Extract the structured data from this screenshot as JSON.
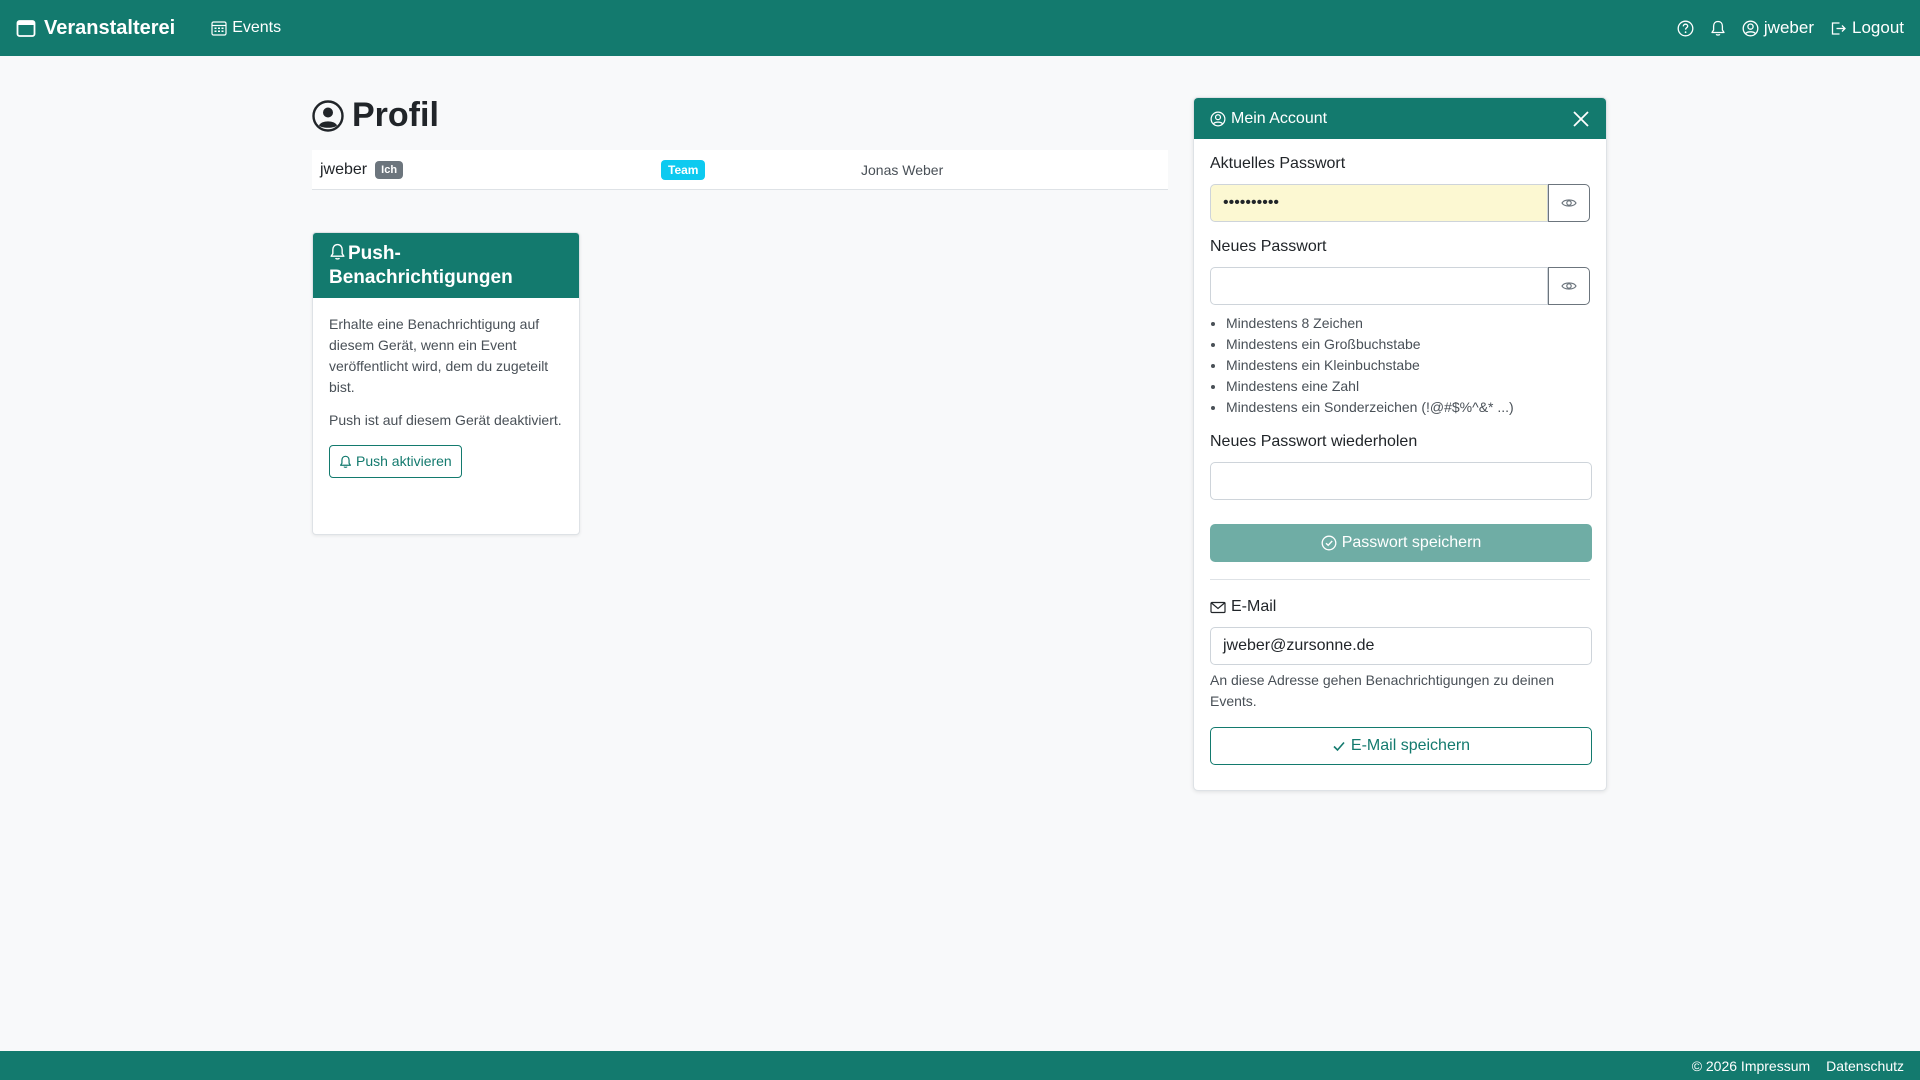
{
  "navbar": {
    "brand": "Veranstalterei",
    "events_label": "Events",
    "username": "jweber",
    "logout_label": "Logout"
  },
  "profile": {
    "title": "Profil",
    "username": "jweber",
    "me_badge": "Ich",
    "role_badge": "Team",
    "full_name": "Jonas Weber"
  },
  "push": {
    "title": "Push-Benachrichtigungen",
    "description": "Erhalte eine Benachrichtigung auf diesem Gerät, wenn ein Event veröffentlicht wird, dem du zugeteilt bist.",
    "status": "Push ist auf diesem Gerät deaktiviert.",
    "button_label": "Push aktivieren"
  },
  "account": {
    "title": "Mein Account",
    "current_password_label": "Aktuelles Passwort",
    "current_password_value": "••••••••••",
    "new_password_label": "Neues Passwort",
    "new_password_value": "",
    "rules": [
      "Mindestens 8 Zeichen",
      "Mindestens ein Großbuchstabe",
      "Mindestens ein Kleinbuchstabe",
      "Mindestens eine Zahl",
      "Mindestens ein Sonderzeichen (!@#$%^&* ...)"
    ],
    "repeat_password_label": "Neues Passwort wiederholen",
    "repeat_password_value": "",
    "save_password_label": "Passwort speichern",
    "email_label": "E-Mail",
    "email_value": "jweber@zursonne.de",
    "email_hint": "An diese Adresse gehen Benachrichtigungen zu deinen Events.",
    "save_email_label": "E-Mail speichern"
  },
  "footer": {
    "copyright": "© 2026 Impressum",
    "privacy": "Datenschutz"
  },
  "colors": {
    "primary": "#137a6e",
    "primary_disabled": "#6fada5",
    "badge_secondary": "#6c757d",
    "badge_info": "#0dcaf0",
    "autofill_bg": "#fcf8d2"
  }
}
